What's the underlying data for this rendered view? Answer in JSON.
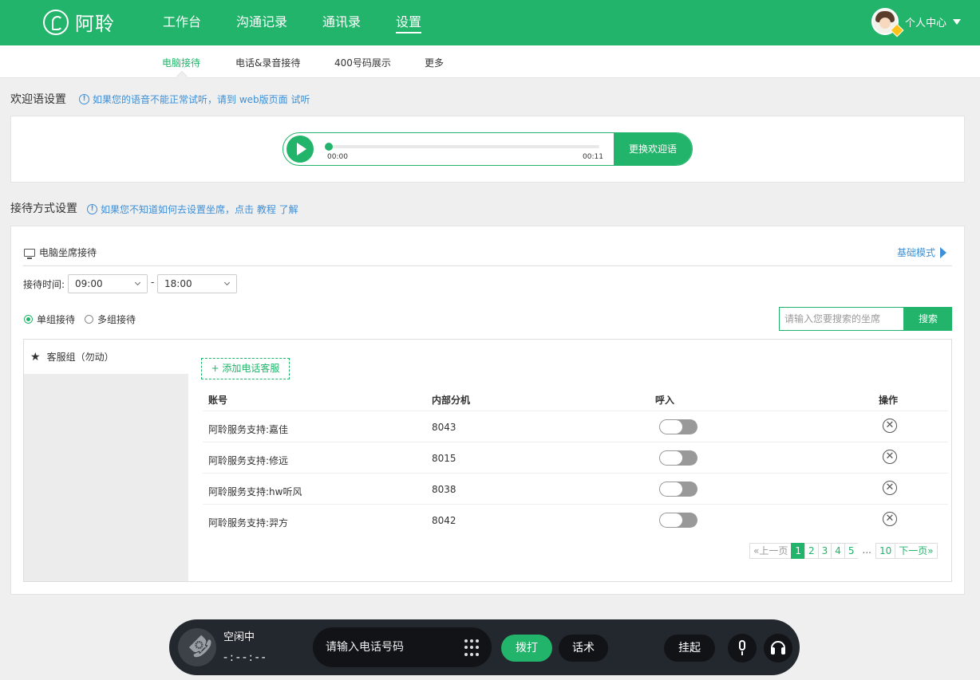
{
  "header": {
    "logo_text": "阿聆",
    "nav": [
      "工作台",
      "沟通记录",
      "通讯录",
      "设置"
    ],
    "active_nav": "设置",
    "user_label": "个人中心"
  },
  "subnav": {
    "items": [
      "电脑接待",
      "电话&录音接待",
      "400号码展示",
      "更多"
    ],
    "active": "电脑接待"
  },
  "welcome": {
    "title": "欢迎语设置",
    "tip": "如果您的语音不能正常试听，请到 web版页面 试听",
    "time_start": "00:00",
    "time_end": "00:11",
    "progress": 0,
    "change_button": "更换欢迎语"
  },
  "reception": {
    "title": "接待方式设置",
    "tip": "如果您不知道如何去设置坐席，点击 教程 了解",
    "pc_label": "电脑坐席接待",
    "basic_mode": "基础模式",
    "time_label": "接待时间:",
    "start_time": "09:00",
    "end_time": "18:00",
    "range_sep": "-",
    "mode_single": "单组接待",
    "mode_multi": "多组接待",
    "selected_mode": "单组接待",
    "search_placeholder": "请输入您要搜索的坐席",
    "search_button": "搜索",
    "group_name": "客服组（勿动）",
    "add_button": "+ 添加电话客服",
    "columns": [
      "账号",
      "内部分机",
      "呼入",
      "操作"
    ],
    "rows": [
      {
        "account": "阿聆服务支持:嘉佳",
        "ext": "8043",
        "inbound": false
      },
      {
        "account": "阿聆服务支持:修远",
        "ext": "8015",
        "inbound": false
      },
      {
        "account": "阿聆服务支持:hw听风",
        "ext": "8038",
        "inbound": false
      },
      {
        "account": "阿聆服务支持:羿方",
        "ext": "8042",
        "inbound": false
      }
    ],
    "pager": {
      "prev": "«上一页",
      "pages": [
        "1",
        "2",
        "3",
        "4",
        "5"
      ],
      "dots": "...",
      "last": "10",
      "next": "下一页»",
      "current": "1"
    }
  },
  "callbar": {
    "status": "空闲中",
    "timer": "-:--:--",
    "input_placeholder": "请输入电话号码",
    "dial": "拨打",
    "script": "话术",
    "hold": "挂起"
  },
  "colors": {
    "brand": "#22b46a",
    "link": "#3d8fd6",
    "callbar": "#23272e"
  },
  "icons": [
    "logo-icon",
    "avatar",
    "caret-down-icon",
    "info-icon",
    "play-icon",
    "monitor-icon",
    "triangle-right-icon",
    "star-icon",
    "close-circle-icon",
    "phone-icon",
    "keypad-icon",
    "microphone-icon",
    "headphones-icon"
  ]
}
